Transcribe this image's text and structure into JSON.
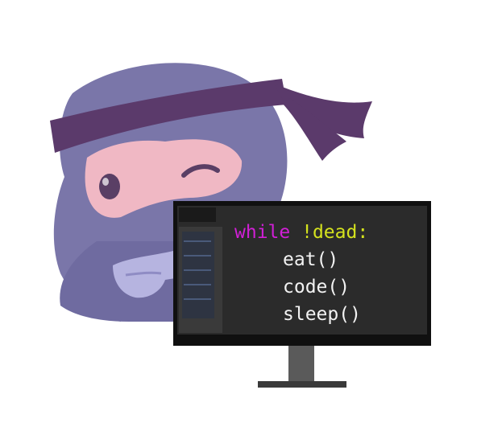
{
  "code": {
    "keyword": "while",
    "condition": " !dead:",
    "lines": [
      "eat()",
      "code()",
      "sleep()"
    ]
  },
  "colors": {
    "ninja_body": "#7a76a9",
    "ninja_body_dark": "#6a6699",
    "headband": "#5b3a6b",
    "mask": "#f0b8c4",
    "hand": "#b6b4e0",
    "monitor_frame": "#101010",
    "monitor_screen": "#2b2b2b",
    "monitor_stand": "#5a5a5a",
    "keyword": "#d11fd6",
    "condition": "#d4e21e",
    "code_text": "#f2f2f2"
  },
  "icons": [
    "ninja-mascot-icon",
    "computer-monitor-icon"
  ]
}
